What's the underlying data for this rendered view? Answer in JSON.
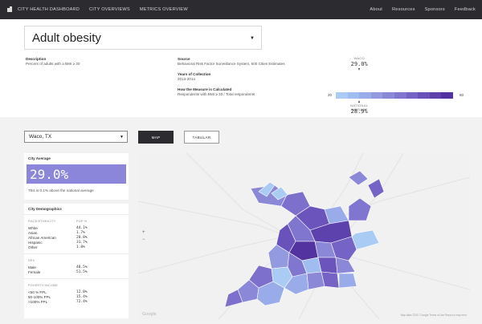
{
  "nav": {
    "brand": "CITY HEALTH DASHBOARD",
    "left_links": [
      "CITY OVERVIEWS",
      "METRICS OVERVIEW"
    ],
    "right_links": [
      "About",
      "Resources",
      "Sponsors",
      "Feedback"
    ]
  },
  "metric": {
    "selected": "Adult obesity",
    "description_title": "Description",
    "description_text": "Percent of adults with a BMI ≥ 30",
    "source_title": "Source",
    "source_text": "Behavioral Risk Factor Surveillance System, 500 Cities Estimates",
    "years_title": "Years of Collection",
    "years_text": "2013-2014",
    "calc_title": "How the Measure is Calculated",
    "calc_text": "Respondents with BMI ≥ 30 / Total respondents"
  },
  "scale": {
    "city_label": "WACO",
    "city_value": "29.0%",
    "city_fraction": 0.2,
    "national_label": "NATIONAL AVERAGE",
    "national_value": "28.9%",
    "national_fraction": 0.2,
    "min": "20",
    "max": "60",
    "colors": [
      "#a9cbf4",
      "#9fbdf0",
      "#9aabe9",
      "#949adf",
      "#8c88d8",
      "#8176cf",
      "#7563c5",
      "#6952b9",
      "#5d42ad",
      "#52339f"
    ]
  },
  "controls": {
    "city": "Waco, TX",
    "map_button": "MAP",
    "tabular_button": "TABULAR"
  },
  "city_average": {
    "title": "City Average",
    "value": "29.0%",
    "note": "This is 0.1% above the national average"
  },
  "demographics": {
    "title": "City Demographics",
    "race_header": "RACE/ETHNICITY",
    "pop_header": "POP %",
    "race": [
      {
        "label": "White",
        "value": "44.1%"
      },
      {
        "label": "Asian",
        "value": "1.7%"
      },
      {
        "label": "African American",
        "value": "20.8%"
      },
      {
        "label": "Hispanic",
        "value": "31.7%"
      },
      {
        "label": "Other",
        "value": "1.8%"
      }
    ],
    "sex_header": "SEX",
    "sex": [
      {
        "label": "Male",
        "value": "48.5%"
      },
      {
        "label": "Female",
        "value": "51.5%"
      }
    ],
    "poverty_header": "POVERTY/INCOME",
    "poverty": [
      {
        "label": "<50 % FPL",
        "value": "12.8%"
      },
      {
        "label": "50-100% FPL",
        "value": "15.4%"
      },
      {
        "label": ">100% FPL",
        "value": "72.4%"
      }
    ]
  },
  "map": {
    "zoom_in": "+",
    "zoom_out": "−",
    "google": "Google",
    "attribution": "Map data ©2017 Google   Terms of Use   Report a map error",
    "colors": {
      "background": "#f1f1f1",
      "light": "#a9cbf4",
      "mid": "#8c88d8",
      "dark": "#5d42ad"
    }
  }
}
